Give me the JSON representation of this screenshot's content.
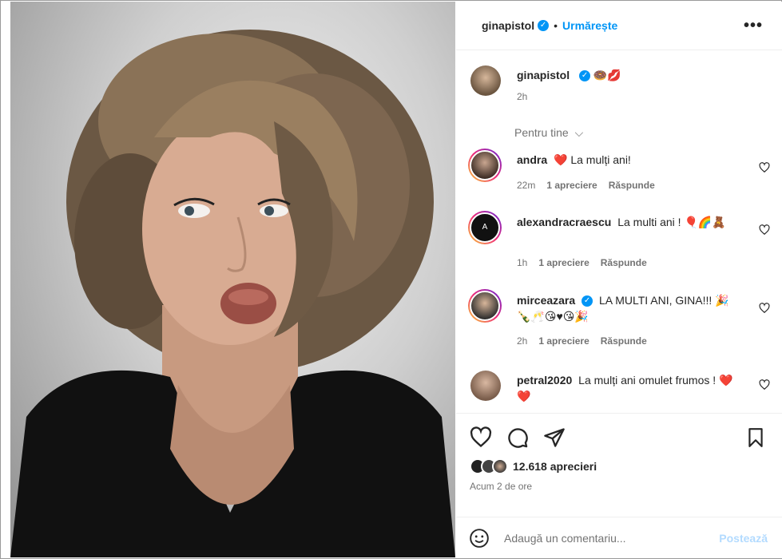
{
  "header": {
    "username": "ginapistol",
    "follow_label": "Urmărește",
    "more_label": "•••"
  },
  "caption": {
    "username": "ginapistol",
    "emojis": "🍩💋",
    "time": "2h"
  },
  "filter": {
    "label": "Pentru tine"
  },
  "comments": [
    {
      "username": "andra",
      "text": "❤️ La mulți ani!",
      "time": "22m",
      "likes": "1 apreciere",
      "reply": "Răspunde",
      "verified": false
    },
    {
      "username": "alexandracraescu",
      "text": "La multi ani ! 🎈🌈🧸",
      "time": "1h",
      "likes": "1 apreciere",
      "reply": "Răspunde",
      "verified": false
    },
    {
      "username": "mirceazara",
      "text": "LA MULTI ANI, GINA!!! 🎉🍾🥂😘♥😘🎉",
      "time": "2h",
      "likes": "1 apreciere",
      "reply": "Răspunde",
      "verified": true
    },
    {
      "username": "petral2020",
      "text": "La mulți ani omulet frumos ! ❤️❤️",
      "verified": false
    }
  ],
  "likes": {
    "count_label": "12.618 aprecieri"
  },
  "posted": {
    "time_label": "Acum 2 de ore"
  },
  "add_comment": {
    "placeholder": "Adaugă un comentariu...",
    "post_label": "Postează"
  },
  "icons": {
    "like": "heart-icon",
    "comment": "comment-icon",
    "share": "share-icon",
    "save": "bookmark-icon",
    "emoji": "emoji-icon",
    "options": "more-icon"
  },
  "colors": {
    "accent": "#0095f6",
    "text": "#262626",
    "muted": "#737373",
    "heart": "#e0122f"
  }
}
